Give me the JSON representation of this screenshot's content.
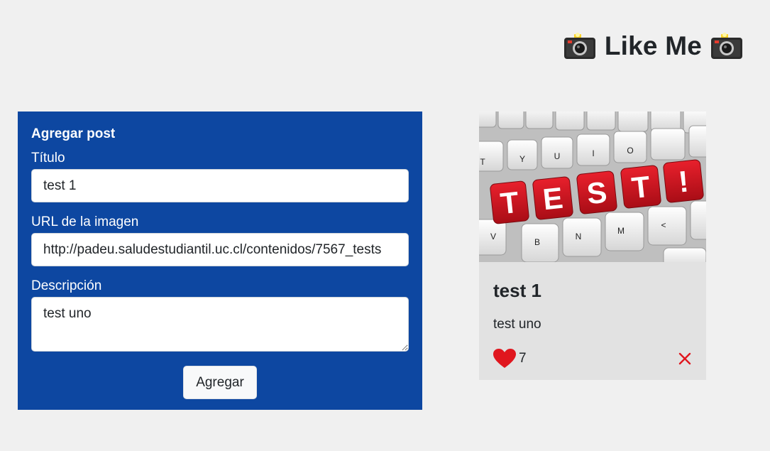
{
  "header": {
    "title": "Like Me",
    "left_icon": "camera-with-flash-icon",
    "right_icon": "camera-with-flash-icon"
  },
  "form": {
    "heading": "Agregar post",
    "title_label": "Título",
    "title_value": "test 1",
    "url_label": "URL de la imagen",
    "url_value": "http://padeu.saludestudiantil.uc.cl/contenidos/7567_tests",
    "description_label": "Descripción",
    "description_value": "test uno",
    "submit_label": "Agregar",
    "background_color": "#0d47a1"
  },
  "posts": [
    {
      "image_text": "TEST!",
      "image_icon": "keyboard-test-keys-image",
      "title": "test 1",
      "description": "test uno",
      "likes": "7",
      "like_icon": "heart-icon",
      "delete_icon": "close-icon",
      "like_color": "#e0161e",
      "delete_color": "#e0161e"
    }
  ]
}
